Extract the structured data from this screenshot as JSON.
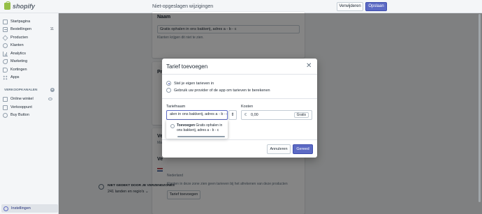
{
  "brand": {
    "name": "shopify"
  },
  "topbar": {
    "title": "Niet-opgeslagen wijzigingen",
    "delete_label": "Verwijderen",
    "save_label": "Opslaan"
  },
  "sidebar": {
    "items": [
      {
        "label": "Startpagina",
        "icon": "home-icon"
      },
      {
        "label": "Bestellingen",
        "icon": "orders-icon",
        "count": "11"
      },
      {
        "label": "Producten",
        "icon": "products-icon"
      },
      {
        "label": "Klanten",
        "icon": "customers-icon"
      },
      {
        "label": "Analytics",
        "icon": "analytics-icon"
      },
      {
        "label": "Marketing",
        "icon": "marketing-icon"
      },
      {
        "label": "Kortingen",
        "icon": "discounts-icon"
      },
      {
        "label": "Apps",
        "icon": "apps-icon"
      }
    ],
    "channels_heading": "VERKOOPKANALEN",
    "channels": [
      {
        "label": "Online winkel"
      },
      {
        "label": "Verkooppunt"
      },
      {
        "label": "Buy Button"
      }
    ],
    "settings_label": "Instellingen"
  },
  "name_card": {
    "heading": "Naam",
    "value": "Gratis ophalen in ons bakkerij, adres a - b - c",
    "help": "Klanten krijgen dit niet te zien."
  },
  "prices_card": {
    "heading": "Pr"
  },
  "zones_card": {
    "heading1": "Ve",
    "text1": "Ma",
    "heading2": "Ve",
    "country": "Nederland",
    "note": "Klanten in deze zone zien geen tarieven bij het afrekenen van deze producten",
    "add_rate_label": "Tarief toevoegen"
  },
  "uncovered": {
    "title": "NIET GEDEKT DOOR JE VERZENDZONES",
    "summary": "241 landen en regio's"
  },
  "modal": {
    "title": "Tarief toevoegen",
    "option1": "Stel je eigen tarieven in",
    "option2": "Gebruik uw provider of de app om tarieven te berekenen",
    "rate_name_label": "Tariefnaam",
    "rate_name_value": "alen in ons bakkerij, adres a - b - c",
    "cost_label": "Kosten",
    "currency": "€",
    "cost_value": "0,00",
    "free_label": "Gratis",
    "suggestion_bold": "Toevoegen",
    "suggestion_text": "Gratis ophalen in ons bakkerij, adres a - b - c",
    "cancel_label": "Annuleren",
    "done_label": "Gereed"
  }
}
